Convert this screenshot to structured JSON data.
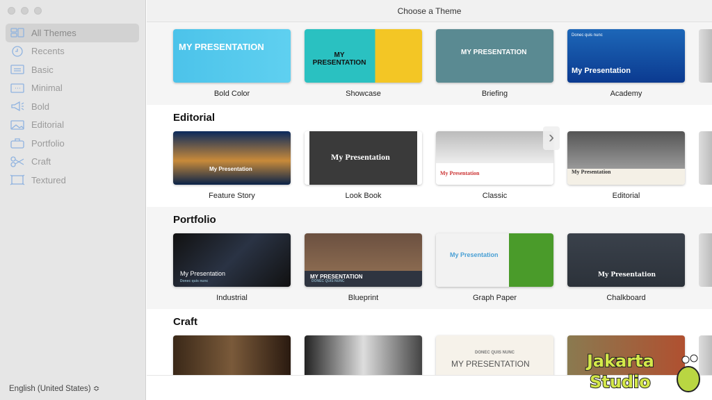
{
  "window": {
    "title": "Choose a Theme"
  },
  "sidebar": {
    "items": [
      {
        "label": "All Themes",
        "icon": "grid-icon",
        "active": true
      },
      {
        "label": "Recents",
        "icon": "clock-icon"
      },
      {
        "label": "Basic",
        "icon": "basic-slide-icon"
      },
      {
        "label": "Minimal",
        "icon": "minimal-slide-icon"
      },
      {
        "label": "Bold",
        "icon": "megaphone-icon"
      },
      {
        "label": "Editorial",
        "icon": "image-icon"
      },
      {
        "label": "Portfolio",
        "icon": "briefcase-icon"
      },
      {
        "label": "Craft",
        "icon": "scissors-icon"
      },
      {
        "label": "Textured",
        "icon": "textured-frame-icon"
      }
    ],
    "language": "English (United States) ≎"
  },
  "sections": [
    {
      "heading": "",
      "themes": [
        {
          "name": "Bold Color",
          "text": "MY PRESENTATION"
        },
        {
          "name": "Showcase",
          "text": "MY PRESENTATION"
        },
        {
          "name": "Briefing",
          "text": "MY PRESENTATION"
        },
        {
          "name": "Academy",
          "text": "My Presentation",
          "sub": "Donec quis nunc"
        }
      ]
    },
    {
      "heading": "Editorial",
      "themes": [
        {
          "name": "Feature Story",
          "text": "My Presentation"
        },
        {
          "name": "Look Book",
          "text": "My Presentation"
        },
        {
          "name": "Classic",
          "text": "My Presentation"
        },
        {
          "name": "Editorial",
          "text": "My Presentation"
        }
      ]
    },
    {
      "heading": "Portfolio",
      "themes": [
        {
          "name": "Industrial",
          "text": "My Presentation",
          "sub": "Donec quis nunc"
        },
        {
          "name": "Blueprint",
          "text": "MY PRESENTATION",
          "sub": "DONEC QUIS NUNC"
        },
        {
          "name": "Graph Paper",
          "text": "My Presentation"
        },
        {
          "name": "Chalkboard",
          "text": "My Presentation"
        }
      ]
    },
    {
      "heading": "Craft",
      "themes": [
        {
          "name": "",
          "text": ""
        },
        {
          "name": "",
          "text": ""
        },
        {
          "name": "",
          "text": "MY PRESENTATION",
          "sub": "DONEC QUIS NUNC"
        },
        {
          "name": "",
          "text": ""
        }
      ]
    }
  ],
  "watermark": {
    "text": "Jakarta Studio"
  }
}
